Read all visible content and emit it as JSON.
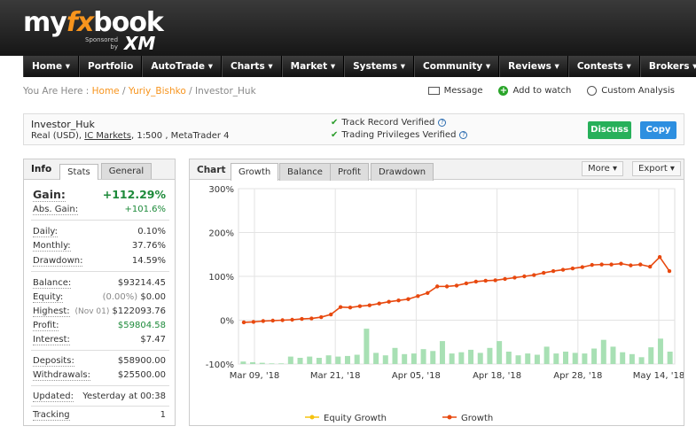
{
  "brand": {
    "logo_pre": "my",
    "logo_fx": "fx",
    "logo_post": "book",
    "sponsored": "Sponsored",
    "by": "by",
    "sponsor": "XM"
  },
  "nav": [
    "Home ▾",
    "Portfolio",
    "AutoTrade ▾",
    "Charts ▾",
    "Market ▾",
    "Systems ▾",
    "Community ▾",
    "Reviews ▾",
    "Contests ▾",
    "Brokers ▾"
  ],
  "breadcrumb": {
    "prefix": "You Are Here : ",
    "home": "Home",
    "sep": " / ",
    "user": "Yuriy_Bishko",
    "current": "Investor_Huk"
  },
  "actions": {
    "message": "Message",
    "watch": "Add to watch",
    "custom": "Custom Analysis"
  },
  "account": {
    "name": "Investor_Huk",
    "detail_pre": "Real (USD), ",
    "broker": "IC Markets",
    "detail_post": ", 1:500 , MetaTrader 4",
    "verified1": "Track Record Verified",
    "verified2": "Trading Privileges Verified",
    "discuss": "Discuss",
    "copy": "Copy"
  },
  "info": {
    "title": "Info",
    "tab_stats": "Stats",
    "tab_general": "General",
    "gain_label": "Gain:",
    "gain": "+112.29%",
    "absgain_label": "Abs. Gain:",
    "absgain": "+101.6%",
    "daily_label": "Daily:",
    "daily": "0.10%",
    "monthly_label": "Monthly:",
    "monthly": "37.76%",
    "drawdown_label": "Drawdown:",
    "drawdown": "14.59%",
    "balance_label": "Balance:",
    "balance": "$93214.45",
    "equity_label": "Equity:",
    "equity_pct": "(0.00%)",
    "equity": "$0.00",
    "highest_label": "Highest:",
    "highest_date": "(Nov 01)",
    "highest": "$122093.76",
    "profit_label": "Profit:",
    "profit": "$59804.58",
    "interest_label": "Interest:",
    "interest": "$7.47",
    "deposits_label": "Deposits:",
    "deposits": "$58900.00",
    "withdrawals_label": "Withdrawals:",
    "withdrawals": "$25500.00",
    "updated_label": "Updated:",
    "updated": "Yesterday at 00:38",
    "tracking_label": "Tracking",
    "tracking": "1"
  },
  "chart_panel": {
    "title": "Chart",
    "tabs": [
      "Growth",
      "Balance",
      "Profit",
      "Drawdown"
    ],
    "more": "More",
    "export": "Export"
  },
  "chart_data": {
    "type": "line",
    "ylim": [
      -100,
      300
    ],
    "yticks": [
      "300%",
      "200%",
      "100%",
      "0%",
      "-100%"
    ],
    "xticks": [
      "Mar 09, '18",
      "Mar 21, '18",
      "Apr 05, '18",
      "Apr 18, '18",
      "Apr 28, '18",
      "May 14, '18"
    ],
    "series": [
      {
        "name": "Equity Growth",
        "color": "#f5c20f",
        "values": []
      },
      {
        "name": "Growth",
        "color": "#e8490f",
        "values": [
          -5,
          -4,
          -2,
          -1,
          0,
          1,
          3,
          4,
          7,
          13,
          30,
          29,
          32,
          34,
          38,
          42,
          45,
          48,
          55,
          62,
          77,
          77,
          79,
          84,
          88,
          90,
          91,
          94,
          97,
          100,
          103,
          108,
          112,
          115,
          118,
          121,
          126,
          127,
          127,
          129,
          125,
          127,
          122,
          144,
          112
        ]
      }
    ],
    "bars": [
      4,
      3,
      2,
      1,
      1,
      12,
      10,
      12,
      10,
      14,
      12,
      13,
      15,
      57,
      18,
      14,
      26,
      16,
      17,
      24,
      21,
      37,
      17,
      19,
      23,
      18,
      26,
      37,
      20,
      14,
      17,
      15,
      28,
      17,
      20,
      18,
      17,
      25,
      39,
      28,
      19,
      16,
      11,
      27,
      41,
      20
    ]
  }
}
